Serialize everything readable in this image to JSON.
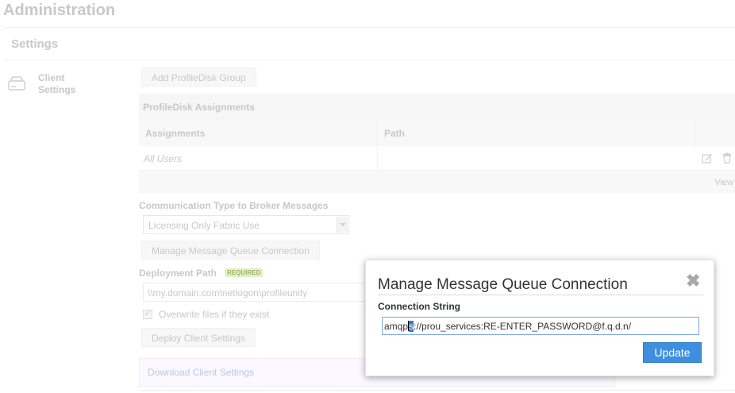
{
  "page": {
    "title": "Administration"
  },
  "section": {
    "title": "Settings"
  },
  "sidebar": {
    "item_label": "Client Settings",
    "item_icon": "hard-drive-icon"
  },
  "toolbar": {
    "add_group_label": "Add ProfileDisk Group"
  },
  "assignments_table": {
    "title": "ProfileDisk Assignments",
    "columns": [
      "Assignments",
      "Path"
    ],
    "rows": [
      {
        "assignment": "All Users",
        "path": ""
      }
    ],
    "row_actions": [
      "edit-icon",
      "trash-icon"
    ],
    "footer_text": "View"
  },
  "communication": {
    "label": "Communication Type to Broker Messages",
    "selected": "Licensing Only Fabric Use",
    "manage_button": "Manage Message Queue Connection"
  },
  "deployment": {
    "label": "Deployment Path",
    "badge": "REQUIRED",
    "value": "\\\\my.domain.com\\netlogon\\profileunity",
    "overwrite_label": "Overwrite files if they exist",
    "overwrite_checked": true,
    "deploy_button": "Deploy Client Settings",
    "download_link": "Download Client Settings"
  },
  "modal": {
    "title": "Manage Message Queue Connection",
    "close_icon": "close-icon",
    "field_label": "Connection String",
    "value_before": "amqp",
    "value_selected": "s",
    "value_after": "://prou_services:RE-ENTER_PASSWORD@f.q.d.n/",
    "update_button": "Update"
  },
  "colors": {
    "accent": "#3f8fde",
    "selection": "#3a79c9"
  }
}
